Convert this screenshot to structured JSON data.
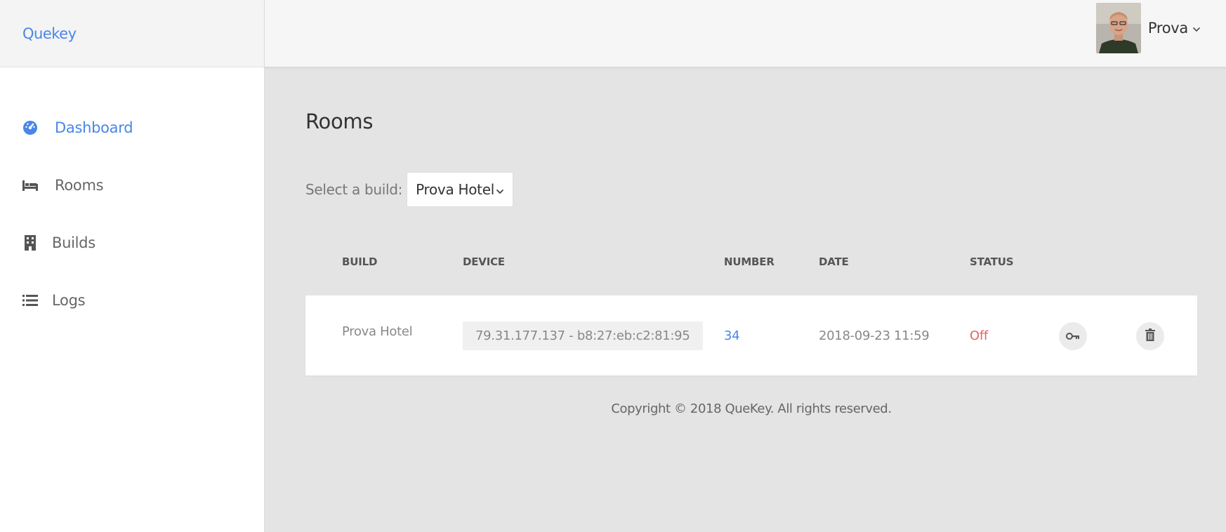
{
  "app": {
    "brand": "Quekey"
  },
  "sidebar": {
    "items": [
      {
        "label": "Dashboard",
        "icon": "dashboard-icon",
        "active": true
      },
      {
        "label": "Rooms",
        "icon": "bed-icon",
        "active": false
      },
      {
        "label": "Builds",
        "icon": "building-icon",
        "active": false
      },
      {
        "label": "Logs",
        "icon": "list-icon",
        "active": false
      }
    ]
  },
  "header": {
    "user_name": "Prova"
  },
  "main": {
    "title": "Rooms",
    "filter": {
      "label": "Select a build:",
      "selected": "Prova Hotel"
    },
    "table": {
      "columns": [
        "BUILD",
        "DEVICE",
        "NUMBER",
        "DATE",
        "STATUS"
      ],
      "rows": [
        {
          "build": "Prova Hotel",
          "device": "79.31.177.137 - b8:27:eb:c2:81:95",
          "number": "34",
          "date": "2018-09-23 11:59",
          "status": "Off"
        }
      ]
    },
    "footer": "Copyright © 2018 QueKey. All rights reserved."
  },
  "colors": {
    "accent": "#4a86e8",
    "status_off": "#e06666",
    "background": "#e4e4e4"
  }
}
